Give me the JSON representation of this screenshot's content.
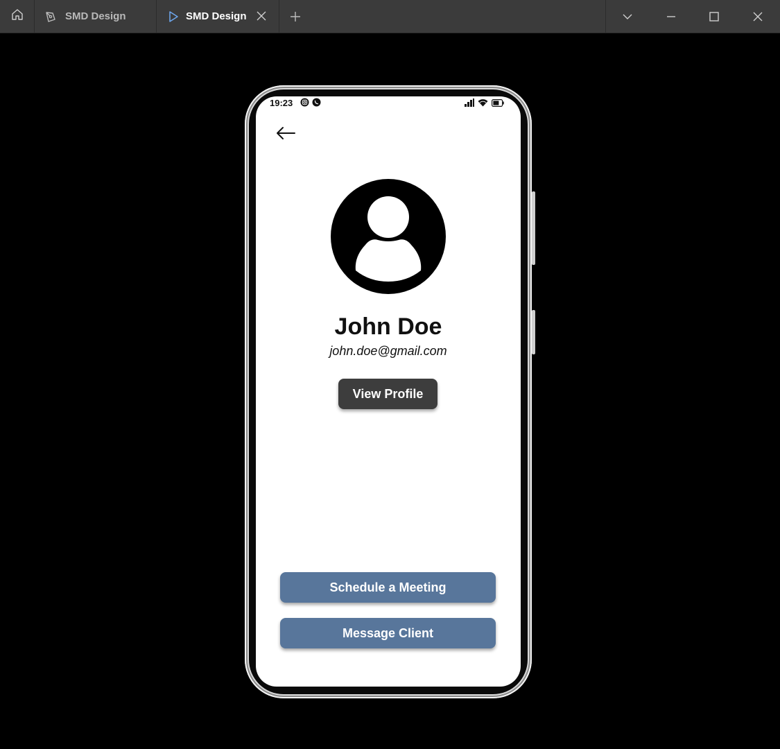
{
  "window": {
    "tabs": [
      {
        "label": "SMD Design",
        "icon": "pen-nib-icon",
        "active": false
      },
      {
        "label": "SMD Design",
        "icon": "play-icon",
        "active": true
      }
    ],
    "icons": {
      "home": "home-icon",
      "close_tab": "close-icon",
      "new_tab": "plus-icon",
      "menu": "chevron-down-icon",
      "minimize": "minimize-icon",
      "maximize": "maximize-icon",
      "close_window": "close-icon"
    },
    "colors": {
      "titlebar": "#3b3b3b",
      "active_tab_icon": "#6ea8f0",
      "background": "#000000"
    }
  },
  "phone": {
    "status_bar": {
      "time": "19:23",
      "notification_icons": [
        "instagram-icon",
        "whatsapp-icon"
      ],
      "system_icons": [
        "signal-icon",
        "wifi-icon",
        "battery-icon"
      ]
    },
    "screen": {
      "back_icon": "arrow-left-icon",
      "avatar_icon": "user-avatar-icon",
      "name": "John Doe",
      "email": "john.doe@gmail.com",
      "view_profile_label": "View Profile",
      "schedule_label": "Schedule a Meeting",
      "message_label": "Message Client"
    },
    "colors": {
      "primary_button": "#58769b",
      "dark_button": "#3d3d3d"
    }
  }
}
